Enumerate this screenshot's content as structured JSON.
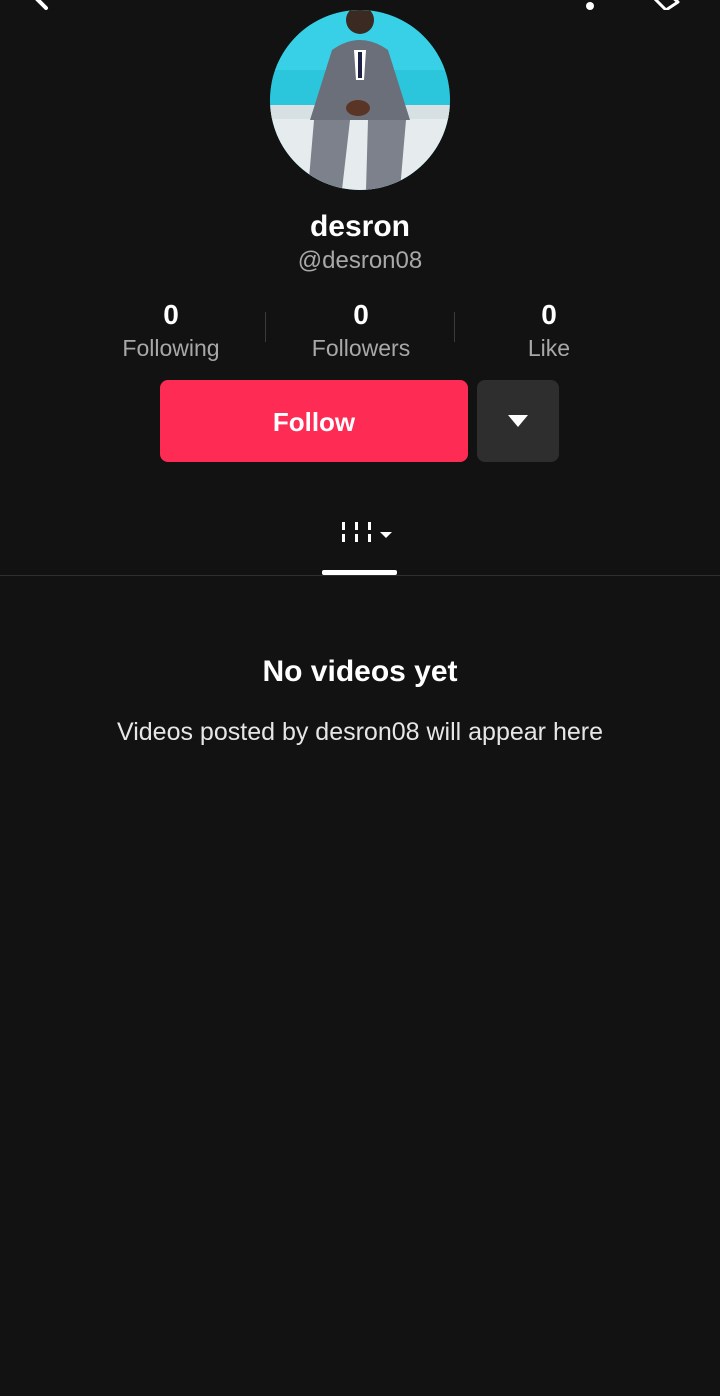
{
  "profile": {
    "display_name": "desron",
    "username": "@desron08"
  },
  "stats": [
    {
      "value": "0",
      "label": "Following"
    },
    {
      "value": "0",
      "label": "Followers"
    },
    {
      "value": "0",
      "label": "Like"
    }
  ],
  "actions": {
    "follow_label": "Follow",
    "more_icon": "caret-down-icon"
  },
  "tabs": {
    "active": "videos-grid-icon"
  },
  "empty_state": {
    "title": "No videos yet",
    "subtitle": "Videos posted by desron08 will appear here"
  },
  "colors": {
    "background": "#121212",
    "accent": "#fe2c55",
    "secondary_button": "#2e2e2e",
    "muted_text": "#a8a8a8"
  }
}
